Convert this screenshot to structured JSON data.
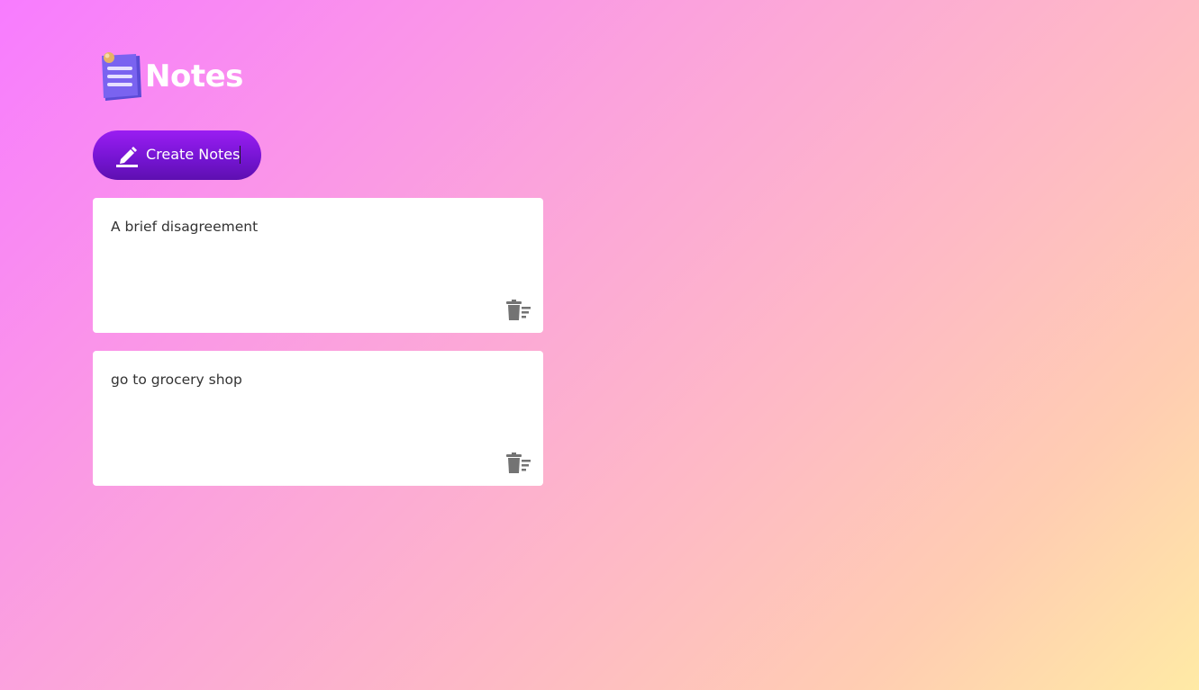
{
  "app": {
    "title": "Notes",
    "logo_icon": "notepad-icon"
  },
  "toolbar": {
    "create_label": "Create Notes",
    "create_icon": "pencil-icon"
  },
  "notes": [
    {
      "text": "A brief disagreement",
      "delete_icon": "delete-note-icon"
    },
    {
      "text": "go to grocery shop",
      "delete_icon": "delete-note-icon"
    }
  ],
  "colors": {
    "background_start": "#f87cff",
    "background_end": "#ffeaa5",
    "button": "#7314d0",
    "card": "#ffffff",
    "icon_gray": "#737373"
  }
}
